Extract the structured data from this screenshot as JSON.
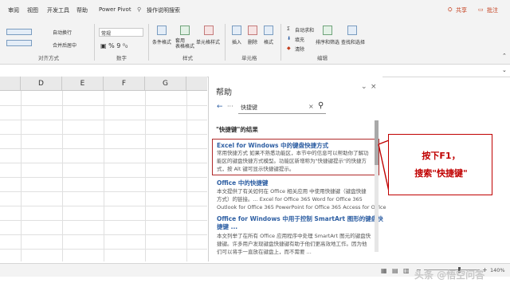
{
  "menu": {
    "items": [
      "审阅",
      "视图",
      "开发工具",
      "帮助",
      "Power Pivot"
    ],
    "tell_me": "操作说明搜索",
    "share": "共享",
    "comment": "批注"
  },
  "ribbon": {
    "wrap_text": "自动换行",
    "merge_center": "合并后居中",
    "number_format": "常规",
    "cond_format": "条件格式",
    "table_format": "套用\n表格格式",
    "cell_style": "单元格样式",
    "insert": "插入",
    "delete": "删除",
    "format": "格式",
    "autosum": "自动求和",
    "fill": "填充",
    "clear": "清除",
    "sort_filter": "排序和筛选",
    "find_select": "查找和选择",
    "groups": {
      "alignment": "对齐方式",
      "number": "数字",
      "styles": "样式",
      "cells": "单元格",
      "editing": "编辑"
    }
  },
  "sheet": {
    "columns": [
      "D",
      "E",
      "F",
      "G"
    ]
  },
  "help_pane": {
    "title": "帮助",
    "search_value": "快捷键",
    "results_heading": "\"快捷键\"的结果",
    "results": [
      {
        "title_lines": [
          "Excel for Windows 中的键盘快捷方式"
        ],
        "desc_lines": [
          "常用快捷方式 如果不熟悉功能区，本节中的信息可以帮助你了解功",
          "能区的键盘快捷方式模型。功能区新增称为\"快捷键提示\"的快捷方",
          "式，按 Alt 键可显示快捷键提示。"
        ]
      },
      {
        "title_lines": [
          "Office 中的快捷键"
        ],
        "desc_lines": [
          "本文提供了有关如何在 Office 相关应用 中使用快捷键（键盘快捷",
          "方式）的链接。... Excel for Office 365 Word for Office 365",
          "Outlook for Office 365 PowerPoint for Office 365 Access for Office"
        ]
      },
      {
        "title_lines": [
          "Office for Windows 中用于控制 SmartArt 图形的键盘快",
          "捷键 ..."
        ],
        "desc_lines": [
          "本文列举了在所有 Office 应用程序中处理 SmartArt 图元的键盘快",
          "捷键。许多用户发现键盘快捷键有助于他们更高效地工作。因为他",
          "们可以将手一直放在键盘上，而不需要 ..."
        ]
      }
    ]
  },
  "status": {
    "zoom": "140%"
  },
  "annotation": {
    "lines": [
      "按下F1，",
      "搜索\"快捷键\""
    ]
  },
  "watermark": "头条 @悟空问答",
  "colors": {
    "annotation": "#c00000",
    "link": "#2e5fa3",
    "accent": "#c43e1c"
  }
}
